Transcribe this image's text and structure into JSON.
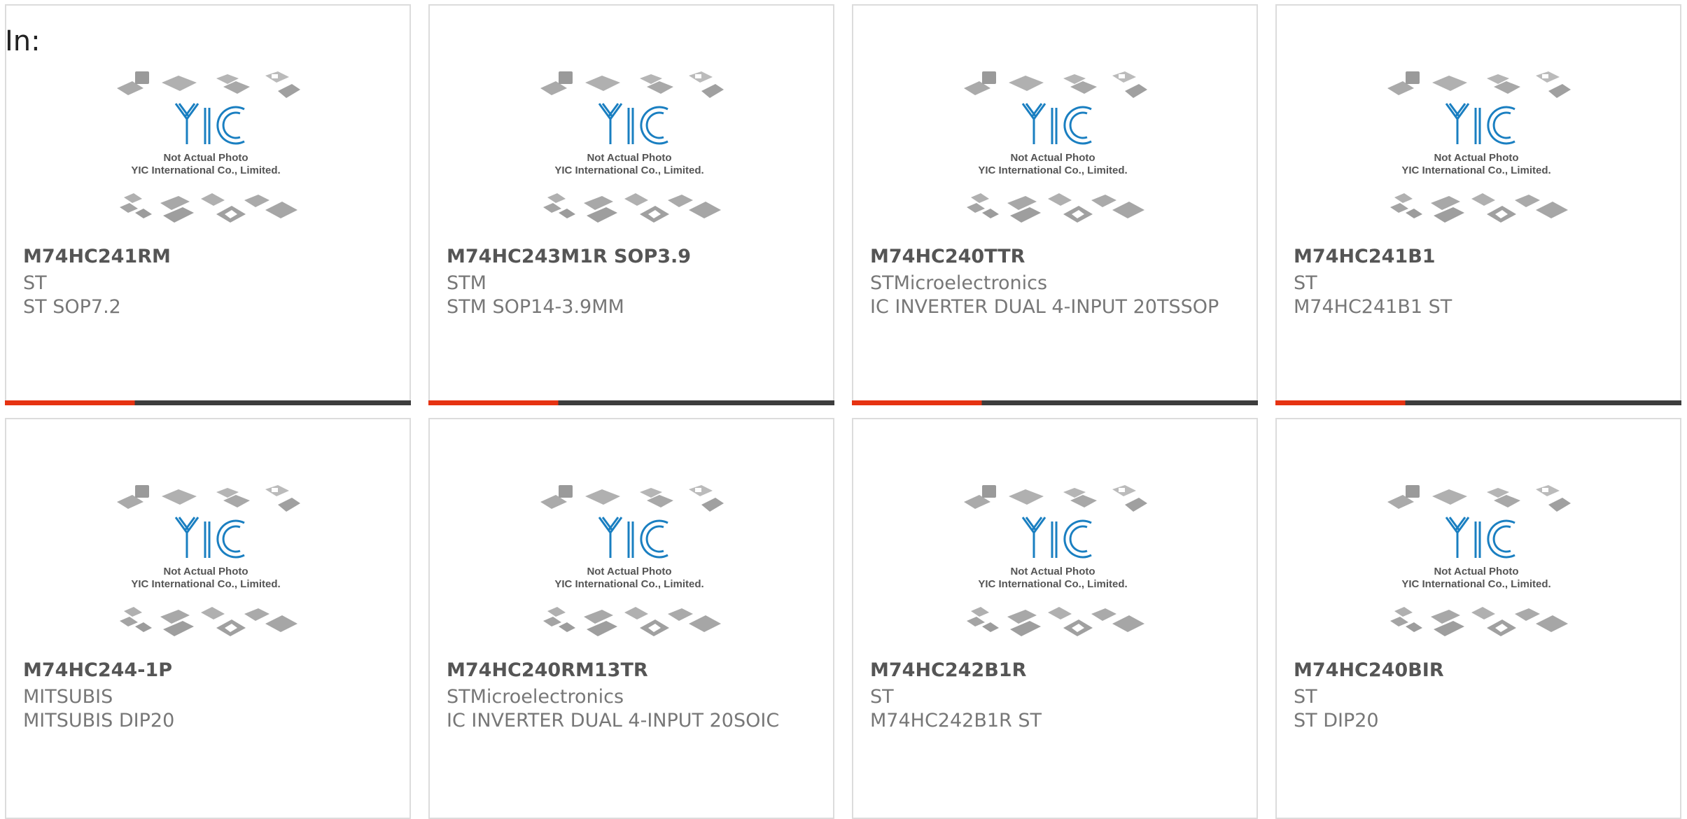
{
  "header": {
    "label": "In:"
  },
  "thumbnail": {
    "caption1": "Not Actual Photo",
    "caption2": "YIC International Co., Limited.",
    "logo_text": "YIC"
  },
  "colors": {
    "accent": "#e63312",
    "bar_dark": "#3d3d3d",
    "border": "#dcdcdc",
    "text_bold": "#555555",
    "text": "#777777",
    "logo_blue": "#1a7fc1"
  },
  "products": [
    {
      "part": "M74HC241RM",
      "maker": "ST",
      "desc": "ST SOP7.2"
    },
    {
      "part": "M74HC243M1R SOP3.9",
      "maker": "STM",
      "desc": "STM SOP14-3.9MM"
    },
    {
      "part": "M74HC240TTR",
      "maker": "STMicroelectronics",
      "desc": "IC INVERTER DUAL 4-INPUT 20TSSOP"
    },
    {
      "part": "M74HC241B1",
      "maker": "ST",
      "desc": "M74HC241B1 ST"
    },
    {
      "part": "M74HC244-1P",
      "maker": "MITSUBIS",
      "desc": "MITSUBIS DIP20"
    },
    {
      "part": "M74HC240RM13TR",
      "maker": "STMicroelectronics",
      "desc": "IC INVERTER DUAL 4-INPUT 20SOIC"
    },
    {
      "part": "M74HC242B1R",
      "maker": "ST",
      "desc": "M74HC242B1R ST"
    },
    {
      "part": "M74HC240BIR",
      "maker": "ST",
      "desc": "ST DIP20"
    }
  ]
}
